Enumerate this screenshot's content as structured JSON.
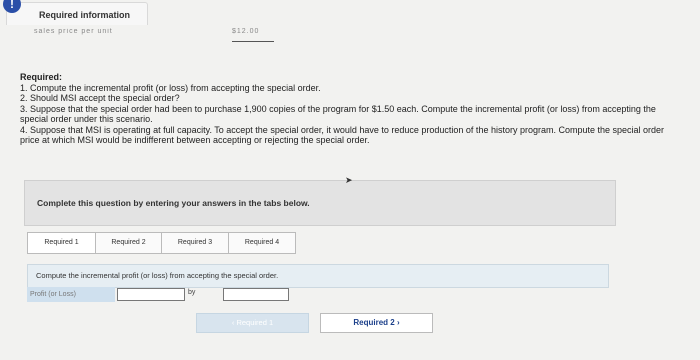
{
  "header": {
    "info_icon": "!",
    "title": "Required information",
    "faded_left": "sales price per unit",
    "faded_right": "$12.00"
  },
  "requirements": {
    "heading": "Required:",
    "items": [
      "1. Compute the incremental profit (or loss) from accepting the special order.",
      "2. Should MSI accept the special order?",
      "3. Suppose that the special order had been to purchase 1,900 copies of the program for $1.50 each. Compute the incremental profit (or loss) from accepting the special order under this scenario.",
      "4. Suppose that MSI is operating at full capacity. To accept the special order, it would have to reduce production of the history program. Compute the special order price at which MSI would be indifferent between accepting or rejecting the special order."
    ]
  },
  "instructions": "Complete this question by entering your answers in the tabs below.",
  "tabs": [
    {
      "label": "Required 1",
      "active": true
    },
    {
      "label": "Required 2",
      "active": false
    },
    {
      "label": "Required 3",
      "active": false
    },
    {
      "label": "Required 4",
      "active": false
    }
  ],
  "question": "Compute the incremental profit (or loss) from accepting the special order.",
  "answer": {
    "label": "Profit (or Loss)",
    "by_text": "by",
    "value1": "",
    "value2": ""
  },
  "navigation": {
    "prev_label": "‹  Required 1",
    "next_label": "Required 2  ›"
  }
}
